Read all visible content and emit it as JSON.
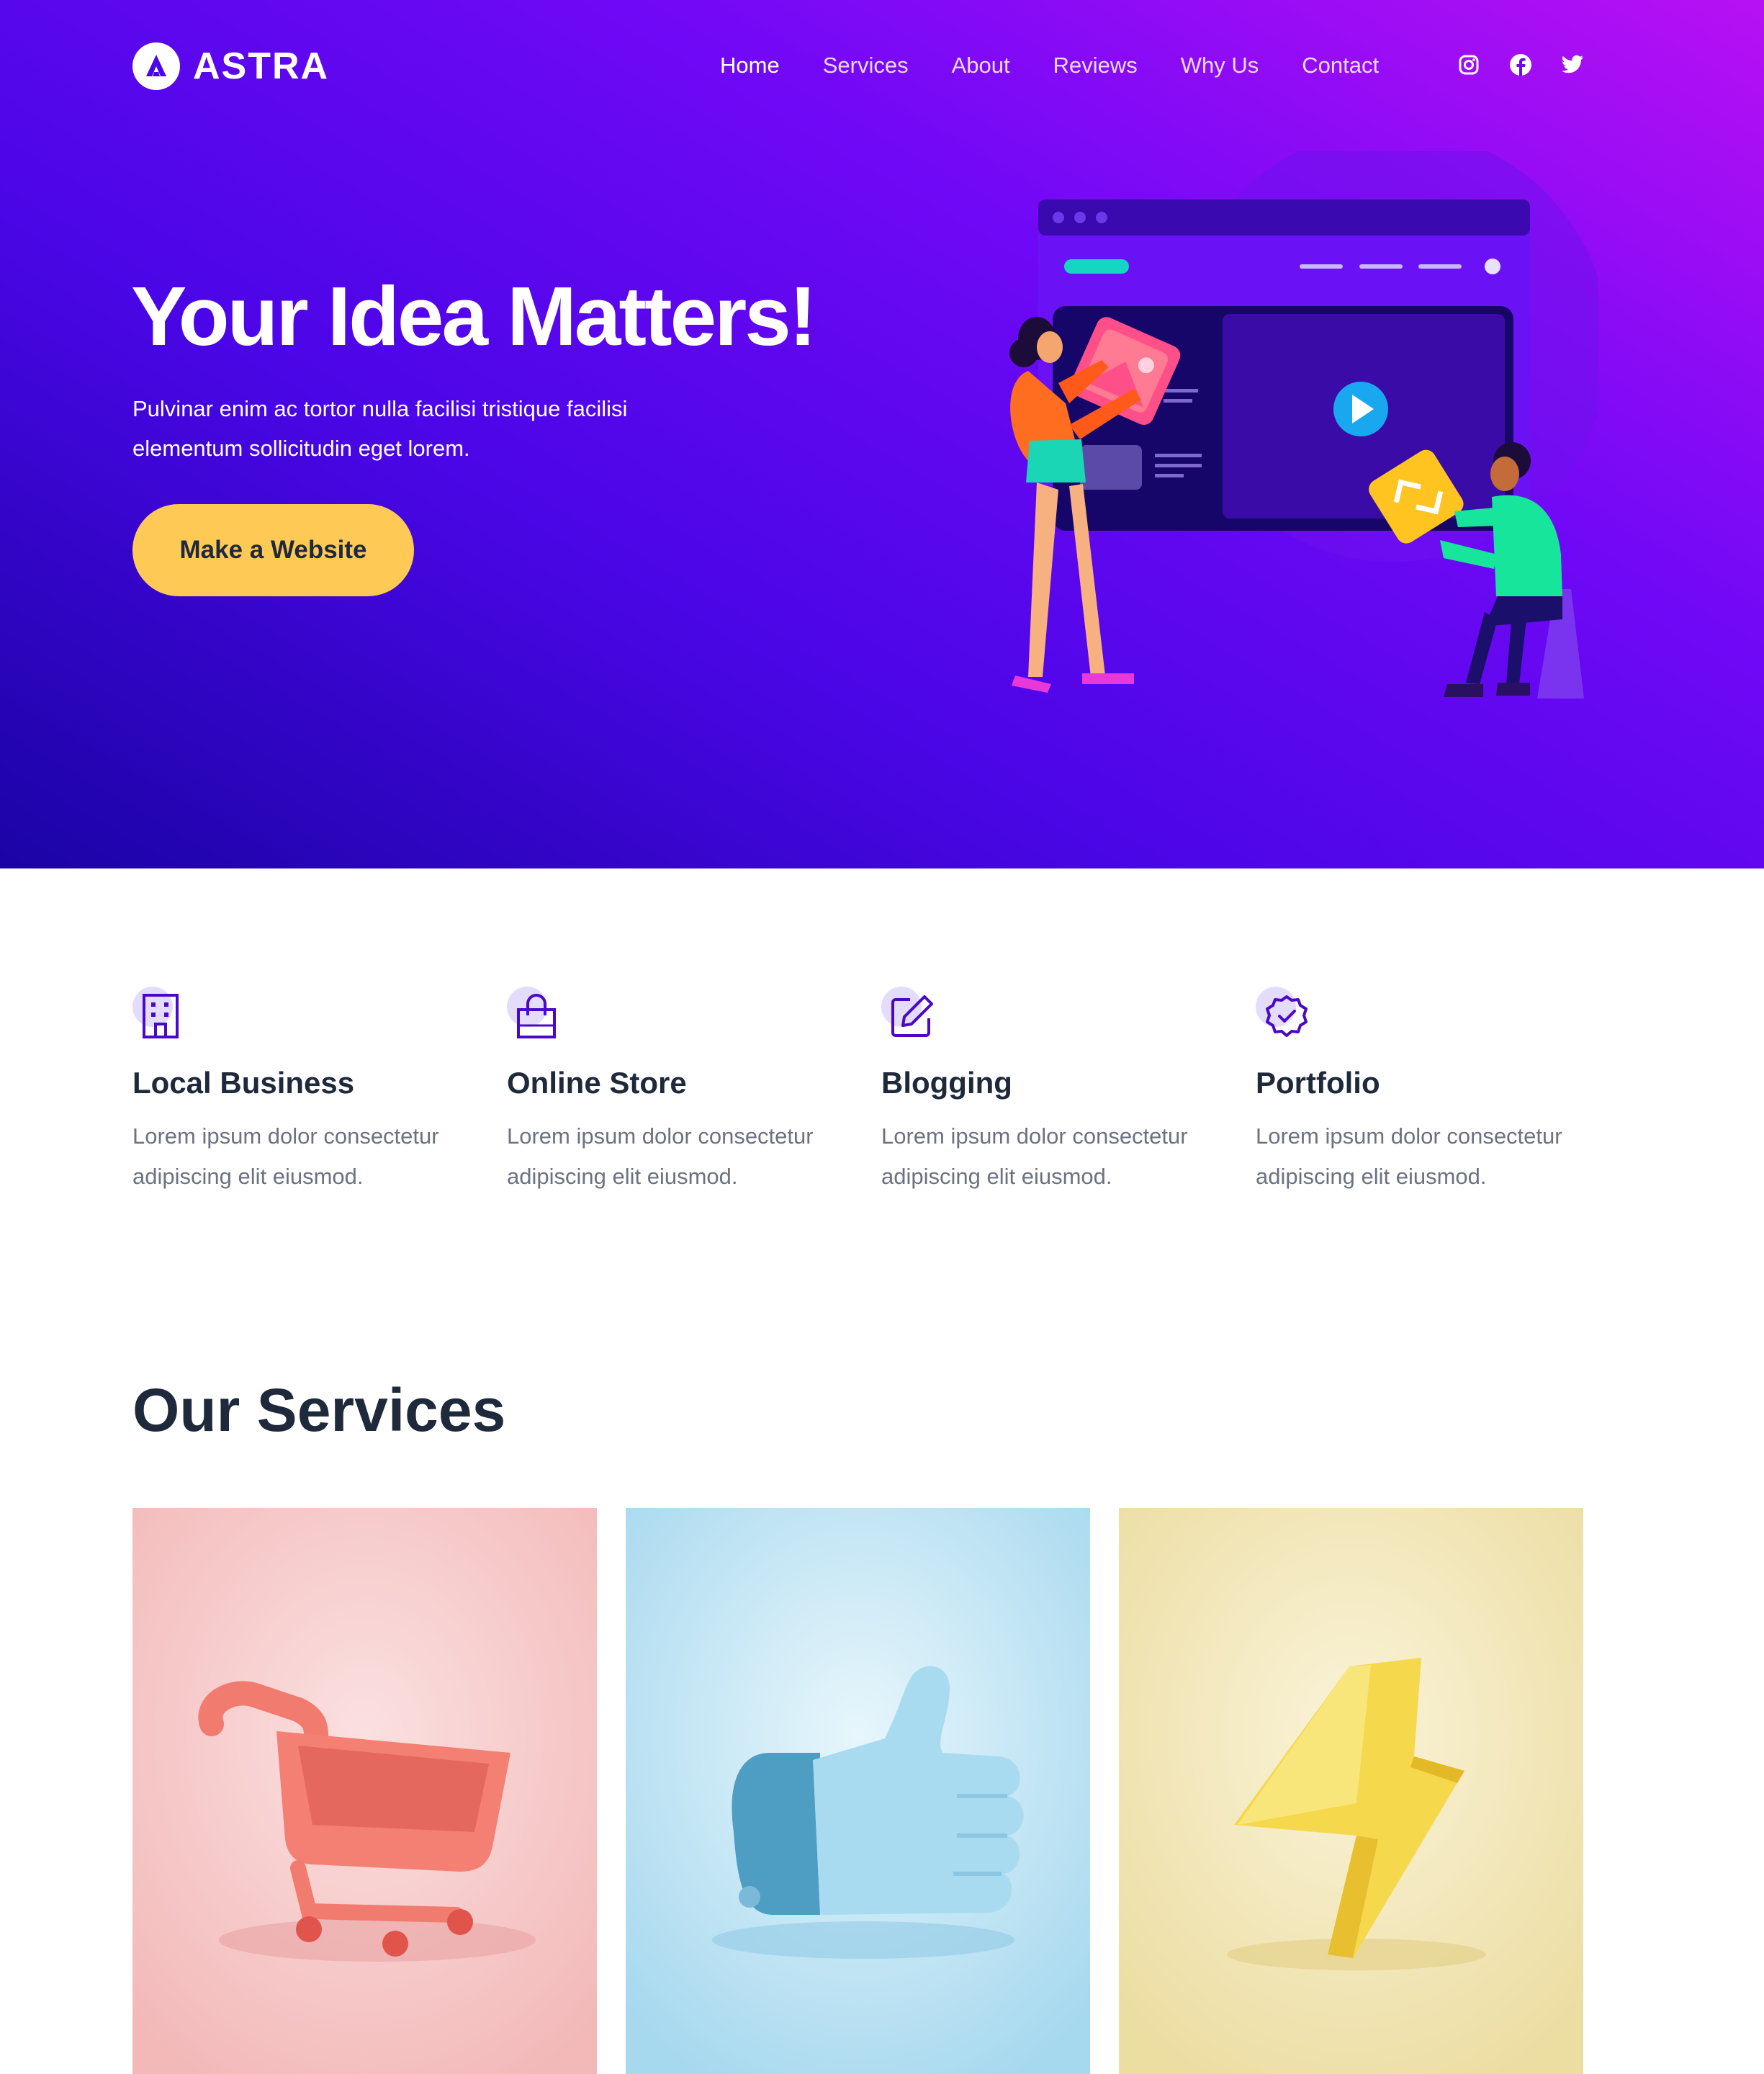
{
  "brand": {
    "name": "ASTRA",
    "logo_icon": "astra-logo-icon"
  },
  "nav": {
    "items": [
      {
        "label": "Home",
        "active": true
      },
      {
        "label": "Services"
      },
      {
        "label": "About"
      },
      {
        "label": "Reviews"
      },
      {
        "label": "Why Us"
      },
      {
        "label": "Contact"
      }
    ],
    "social_icons": [
      "instagram-icon",
      "facebook-icon",
      "twitter-icon"
    ]
  },
  "hero": {
    "title": "Your Idea Matters!",
    "subtitle": "Pulvinar enim ac tortor nulla facilisi tristique facilisi elementum sollicitudin eget lorem.",
    "cta_label": "Make a Website"
  },
  "features": [
    {
      "title": "Local Business",
      "text": "Lorem ipsum dolor consectetur adipiscing elit eiusmod.",
      "icon": "building-icon"
    },
    {
      "title": "Online Store",
      "text": "Lorem ipsum dolor consectetur adipiscing elit eiusmod.",
      "icon": "shopping-bag-icon"
    },
    {
      "title": "Blogging",
      "text": "Lorem ipsum dolor consectetur adipiscing elit eiusmod.",
      "icon": "edit-icon"
    },
    {
      "title": "Portfolio",
      "text": "Lorem ipsum dolor consectetur adipiscing elit eiusmod.",
      "icon": "badge-check-icon"
    }
  ],
  "services": {
    "title": "Our Services",
    "cards": [
      {
        "image": "shopping-cart-3d-image",
        "bg": "#f7c6c6"
      },
      {
        "image": "thumbs-up-3d-image",
        "bg": "#bfe3f3"
      },
      {
        "image": "lightning-bolt-3d-image",
        "bg": "#f1e7b6"
      }
    ]
  },
  "colors": {
    "hero_gradient": [
      "#1a04a5",
      "#6f08f6",
      "#b810f4"
    ],
    "cta": "#ffc955",
    "heading": "#1e293b",
    "body_text": "#6b7280",
    "icon_accent": "#5a12d6"
  }
}
